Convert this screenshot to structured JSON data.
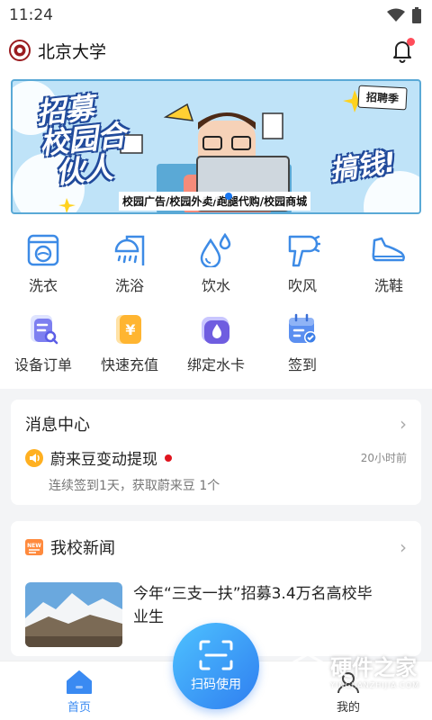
{
  "status_bar": {
    "time": "11:24"
  },
  "header": {
    "school_name": "北京大学"
  },
  "banner": {
    "title_line1": "招募",
    "title_line2": "校园合",
    "title_line3": "伙人",
    "slogan": "搞钱!",
    "badge": "招聘季",
    "caption": "校园广告/校园外卖/跑腿代购/校园商城"
  },
  "services_row1": [
    {
      "label": "洗衣",
      "icon": "washing-machine-icon"
    },
    {
      "label": "洗浴",
      "icon": "shower-icon"
    },
    {
      "label": "饮水",
      "icon": "water-drop-icon"
    },
    {
      "label": "吹风",
      "icon": "hair-dryer-icon"
    },
    {
      "label": "洗鞋",
      "icon": "shoe-icon"
    }
  ],
  "services_row2": [
    {
      "label": "设备订单",
      "icon": "order-icon"
    },
    {
      "label": "快速充值",
      "icon": "recharge-icon"
    },
    {
      "label": "绑定水卡",
      "icon": "water-card-icon"
    },
    {
      "label": "签到",
      "icon": "calendar-check-icon"
    }
  ],
  "message_center": {
    "title": "消息中心",
    "item_title": "蔚来豆变动提现",
    "time": "20小时前",
    "subtitle": "连续签到1天，获取蔚来豆 1个"
  },
  "news": {
    "title": "我校新闻",
    "badge": "NEW",
    "headline_line1": "今年“三支一扶”招募3.4万名高校毕",
    "headline_line2": "业生"
  },
  "tabbar": {
    "home": "首页",
    "scan": "扫码使用",
    "mine": "我的"
  },
  "watermark": {
    "text": "硬件之家",
    "sub": "YINGJIANZHIJIA.COM"
  },
  "colors": {
    "accent": "#3a8af2",
    "icon_blue": "#3d8be6",
    "alert": "#e0141e"
  }
}
